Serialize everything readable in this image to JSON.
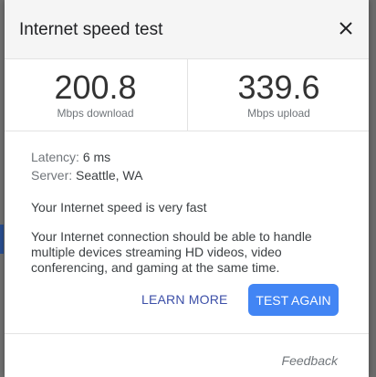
{
  "dialog": {
    "title": "Internet speed test",
    "close_icon": "close-icon"
  },
  "results": {
    "download": {
      "value": "200.8",
      "unit": "Mbps download"
    },
    "upload": {
      "value": "339.6",
      "unit": "Mbps upload"
    }
  },
  "details": {
    "latency_label": "Latency:",
    "latency_value": "6 ms",
    "server_label": "Server:",
    "server_value": "Seattle, WA",
    "verdict": "Your Internet speed is very fast",
    "description": "Your Internet connection should be able to handle multiple devices streaming HD videos, video conferencing, and gaming at the same time."
  },
  "actions": {
    "learn_more": "LEARN MORE",
    "test_again": "TEST AGAIN"
  },
  "footer": {
    "feedback": "Feedback"
  },
  "colors": {
    "accent": "#4285f4",
    "link": "#3c4fa8",
    "text": "#202124",
    "muted": "#70757a"
  }
}
